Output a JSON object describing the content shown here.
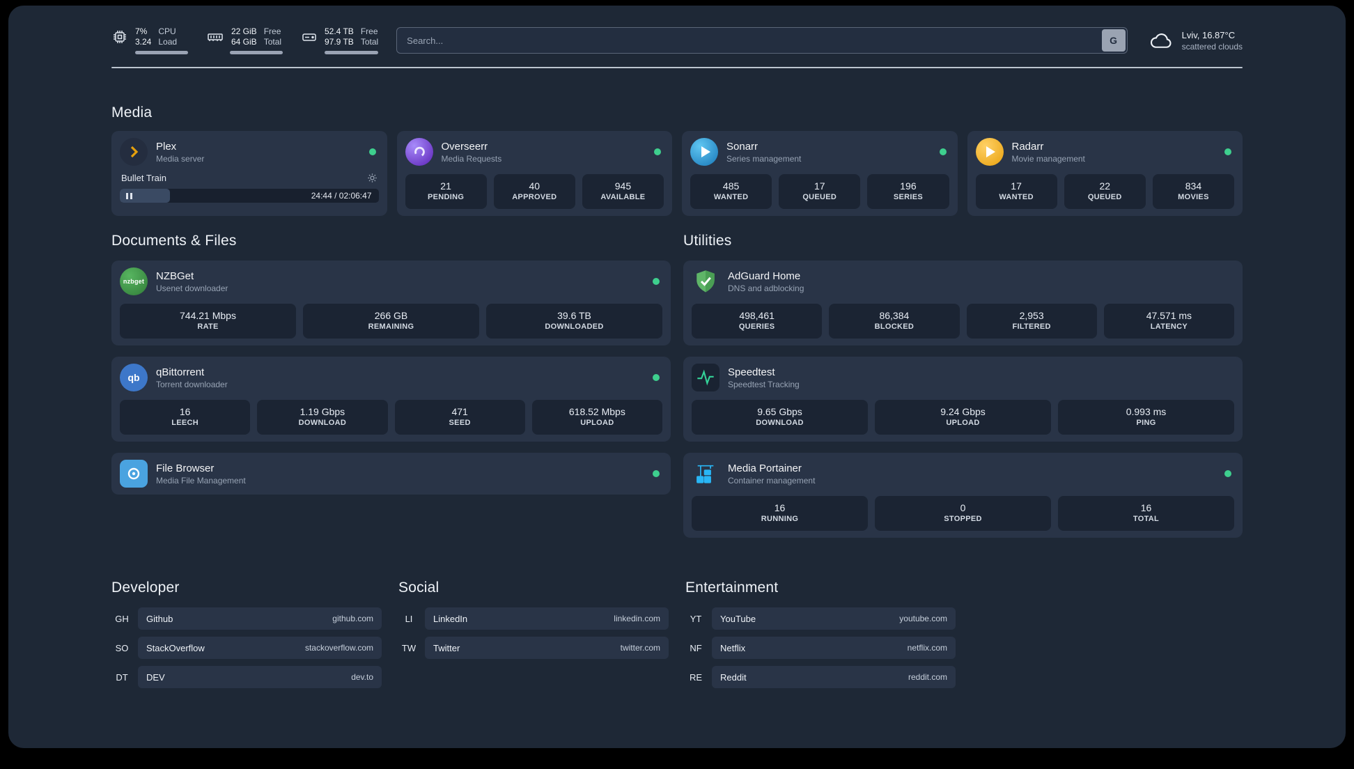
{
  "topbar": {
    "cpu": {
      "v1": "7%",
      "v2": "3.24",
      "l1": "CPU",
      "l2": "Load"
    },
    "ram": {
      "v1": "22 GiB",
      "v2": "64 GiB",
      "l1": "Free",
      "l2": "Total"
    },
    "disk": {
      "v1": "52.4 TB",
      "v2": "97.9 TB",
      "l1": "Free",
      "l2": "Total"
    },
    "search": {
      "placeholder": "Search...",
      "button": "G"
    },
    "weather": {
      "line1": "Lviv, 16.87°C",
      "line2": "scattered clouds"
    }
  },
  "media": {
    "title": "Media",
    "plex": {
      "name": "Plex",
      "subtitle": "Media server",
      "player": {
        "track": "Bullet Train",
        "time": "24:44 / 02:06:47",
        "progress_pct": 19.5
      }
    },
    "overseerr": {
      "name": "Overseerr",
      "subtitle": "Media Requests",
      "stats": [
        {
          "value": "21",
          "label": "PENDING"
        },
        {
          "value": "40",
          "label": "APPROVED"
        },
        {
          "value": "945",
          "label": "AVAILABLE"
        }
      ]
    },
    "sonarr": {
      "name": "Sonarr",
      "subtitle": "Series management",
      "stats": [
        {
          "value": "485",
          "label": "WANTED"
        },
        {
          "value": "17",
          "label": "QUEUED"
        },
        {
          "value": "196",
          "label": "SERIES"
        }
      ]
    },
    "radarr": {
      "name": "Radarr",
      "subtitle": "Movie management",
      "stats": [
        {
          "value": "17",
          "label": "WANTED"
        },
        {
          "value": "22",
          "label": "QUEUED"
        },
        {
          "value": "834",
          "label": "MOVIES"
        }
      ]
    }
  },
  "documents": {
    "title": "Documents & Files",
    "nzbget": {
      "name": "NZBGet",
      "subtitle": "Usenet downloader",
      "icon_text": "nzbget",
      "stats": [
        {
          "value": "744.21 Mbps",
          "label": "RATE"
        },
        {
          "value": "266 GB",
          "label": "REMAINING"
        },
        {
          "value": "39.6 TB",
          "label": "DOWNLOADED"
        }
      ]
    },
    "qbittorrent": {
      "name": "qBittorrent",
      "subtitle": "Torrent downloader",
      "icon_text": "qb",
      "stats": [
        {
          "value": "16",
          "label": "LEECH"
        },
        {
          "value": "1.19 Gbps",
          "label": "DOWNLOAD"
        },
        {
          "value": "471",
          "label": "SEED"
        },
        {
          "value": "618.52 Mbps",
          "label": "UPLOAD"
        }
      ]
    },
    "filebrowser": {
      "name": "File Browser",
      "subtitle": "Media File Management"
    }
  },
  "utilities": {
    "title": "Utilities",
    "adguard": {
      "name": "AdGuard Home",
      "subtitle": "DNS and adblocking",
      "stats": [
        {
          "value": "498,461",
          "label": "QUERIES"
        },
        {
          "value": "86,384",
          "label": "BLOCKED"
        },
        {
          "value": "2,953",
          "label": "FILTERED"
        },
        {
          "value": "47.571 ms",
          "label": "LATENCY"
        }
      ]
    },
    "speedtest": {
      "name": "Speedtest",
      "subtitle": "Speedtest Tracking",
      "stats": [
        {
          "value": "9.65 Gbps",
          "label": "DOWNLOAD"
        },
        {
          "value": "9.24 Gbps",
          "label": "UPLOAD"
        },
        {
          "value": "0.993 ms",
          "label": "PING"
        }
      ]
    },
    "portainer": {
      "name": "Media Portainer",
      "subtitle": "Container management",
      "stats": [
        {
          "value": "16",
          "label": "RUNNING"
        },
        {
          "value": "0",
          "label": "STOPPED"
        },
        {
          "value": "16",
          "label": "TOTAL"
        }
      ]
    }
  },
  "bookmarks": {
    "developer": {
      "title": "Developer",
      "items": [
        {
          "abbr": "GH",
          "name": "Github",
          "domain": "github.com"
        },
        {
          "abbr": "SO",
          "name": "StackOverflow",
          "domain": "stackoverflow.com"
        },
        {
          "abbr": "DT",
          "name": "DEV",
          "domain": "dev.to"
        }
      ]
    },
    "social": {
      "title": "Social",
      "items": [
        {
          "abbr": "LI",
          "name": "LinkedIn",
          "domain": "linkedin.com"
        },
        {
          "abbr": "TW",
          "name": "Twitter",
          "domain": "twitter.com"
        }
      ]
    },
    "entertainment": {
      "title": "Entertainment",
      "items": [
        {
          "abbr": "YT",
          "name": "YouTube",
          "domain": "youtube.com"
        },
        {
          "abbr": "NF",
          "name": "Netflix",
          "domain": "netflix.com"
        },
        {
          "abbr": "RE",
          "name": "Reddit",
          "domain": "reddit.com"
        }
      ]
    }
  }
}
